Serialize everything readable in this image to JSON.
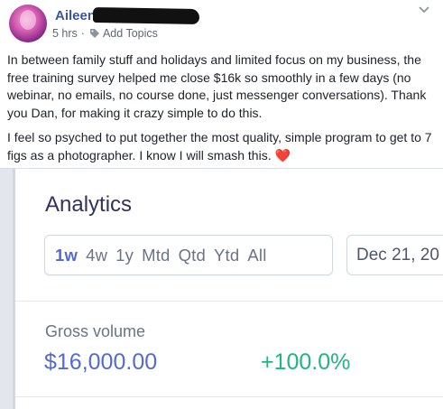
{
  "post": {
    "author": "Aileen",
    "time": "5 hrs",
    "separator": "·",
    "add_topics": "Add Topics",
    "paragraphs": [
      "In between family stuff and holidays and limited focus on my business, the free training survey helped me close $16k so smoothly in a few days (no webinar, no emails, no course done, just messenger conversations). Thank you Dan, for making it crazy simple to do this.",
      "I feel so psyched to put together the most quality, simple program to get to 7 figs as a photographer. I know I will smash this."
    ],
    "heart": "❤️"
  },
  "analytics": {
    "title": "Analytics",
    "ranges": [
      "1w",
      "4w",
      "1y",
      "Mtd",
      "Qtd",
      "Ytd",
      "All"
    ],
    "active_range": "1w",
    "date": "Dec 21, 20",
    "gross_label": "Gross volume",
    "gross_value": "$16,000.00",
    "gross_change": "+100.0%"
  },
  "colors": {
    "author": "#385898",
    "accent": "#5469d4",
    "positive": "#24b47e"
  }
}
